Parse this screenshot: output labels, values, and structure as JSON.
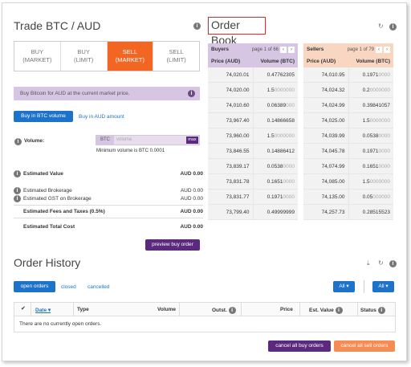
{
  "trade": {
    "title": "Trade BTC / AUD",
    "tabs": [
      {
        "line1": "BUY",
        "line2": "(MARKET)",
        "active": false
      },
      {
        "line1": "BUY",
        "line2": "(LIMIT)",
        "active": false
      },
      {
        "line1": "SELL",
        "line2": "(MARKET)",
        "active": true
      },
      {
        "line1": "SELL",
        "line2": "(LIMIT)",
        "active": false
      }
    ],
    "banner": "Buy Bitcoin for AUD at the current market price.",
    "buy_in_btc": "Buy in BTC volume",
    "buy_in_aud": "Buy in AUD amount",
    "volume_label": "Volume:",
    "currency": "BTC",
    "volume_placeholder": "volume",
    "max_label": "max",
    "min_volume_note": "Minimum volume is BTC 0.0001",
    "estimated_value_label": "Estimated Value",
    "estimated_value": "AUD 0.00",
    "brokerage_label": "Estimated Brokerage",
    "brokerage_value": "AUD 0.00",
    "gst_label": "Estimated GST on Brokerage",
    "gst_value": "AUD 0.00",
    "fees_label": "Estimated Fees and Taxes (0.5%)",
    "fees_value": "AUD 0.00",
    "total_label": "Estimated Total Cost",
    "total_value": "AUD 0.00",
    "preview_button": "preview buy order"
  },
  "order_book": {
    "title": "Order Book",
    "buyers": {
      "label": "Buyers",
      "page": "page 1 of 66",
      "col_price": "Price (AUD)",
      "col_volume": "Volume (BTC)",
      "rows": [
        {
          "price": "74,020.01",
          "vol": "0.47762305",
          "tail": ""
        },
        {
          "price": "74,020.00",
          "vol": "1.5",
          "tail": "0000000"
        },
        {
          "price": "74,010.60",
          "vol": "0.06389",
          "tail": "000"
        },
        {
          "price": "73,967.40",
          "vol": "0.14866658",
          "tail": ""
        },
        {
          "price": "73,960.00",
          "vol": "1.5",
          "tail": "0000000"
        },
        {
          "price": "73,846.55",
          "vol": "0.14886412",
          "tail": ""
        },
        {
          "price": "73,839.17",
          "vol": "0.0538",
          "tail": "0000"
        },
        {
          "price": "73,831.78",
          "vol": "0.1651",
          "tail": "0000"
        },
        {
          "price": "73,831.77",
          "vol": "0.1971",
          "tail": "0000"
        },
        {
          "price": "73,799.40",
          "vol": "0.49999999",
          "tail": ""
        }
      ]
    },
    "sellers": {
      "label": "Sellers",
      "page": "page 1 of 79",
      "col_price": "Price (AUD)",
      "col_volume": "Volume (BTC)",
      "rows": [
        {
          "price": "74,010.95",
          "vol": "0.1971",
          "tail": "0000"
        },
        {
          "price": "74,024.32",
          "vol": "0.2",
          "tail": "0000000"
        },
        {
          "price": "74,024.99",
          "vol": "0.39841057",
          "tail": ""
        },
        {
          "price": "74,025.00",
          "vol": "1.5",
          "tail": "0000000"
        },
        {
          "price": "74,039.99",
          "vol": "0.0538",
          "tail": "0000"
        },
        {
          "price": "74,045.78",
          "vol": "0.1971",
          "tail": "0000"
        },
        {
          "price": "74,074.99",
          "vol": "0.1651",
          "tail": "0000"
        },
        {
          "price": "74,085.00",
          "vol": "1.5",
          "tail": "0000000"
        },
        {
          "price": "74,135.00",
          "vol": "0.05",
          "tail": "000000"
        },
        {
          "price": "74,257.73",
          "vol": "0.28515523",
          "tail": ""
        }
      ]
    }
  },
  "order_history": {
    "title": "Order History",
    "tabs": [
      "open orders",
      "closed",
      "cancelled"
    ],
    "filter_all": "All",
    "filter_all_2": "All",
    "columns": [
      "Date",
      "Type",
      "Volume",
      "Outst.",
      "Price",
      "Est. Value",
      "Status"
    ],
    "empty_message": "There are no currently open orders.",
    "cancel_buy": "cancel all buy orders",
    "cancel_sell": "cancel all sell orders"
  },
  "colors": {
    "accent": "#f26522",
    "blue": "#1d73c9",
    "purple": "#5b2a7e",
    "lavender": "#d7c6e3",
    "peach": "#f9d6c2",
    "orange": "#f68b53"
  }
}
